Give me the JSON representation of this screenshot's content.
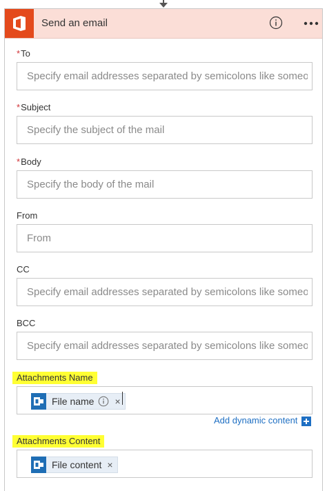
{
  "action_card": {
    "title": "Send an email",
    "header_color": "#fbded7",
    "app_icon": "office-icon",
    "app_icon_color": "#e44a1c"
  },
  "fields": {
    "to": {
      "label": "To",
      "required": true,
      "placeholder": "Specify email addresses separated by semicolons like someone@contoso.com"
    },
    "subject": {
      "label": "Subject",
      "required": true,
      "placeholder": "Specify the subject of the mail"
    },
    "body": {
      "label": "Body",
      "required": true,
      "placeholder": "Specify the body of the mail"
    },
    "from": {
      "label": "From",
      "required": false,
      "placeholder": "From"
    },
    "cc": {
      "label": "CC",
      "required": false,
      "placeholder": "Specify email addresses separated by semicolons like someone@contoso.com"
    },
    "bcc": {
      "label": "BCC",
      "required": false,
      "placeholder": "Specify email addresses separated by semicolons like someone@contoso.com"
    },
    "attachments_name": {
      "label": "Attachments Name",
      "token": {
        "label": "File name",
        "icon": "outlook-icon"
      }
    },
    "attachments_content": {
      "label": "Attachments Content",
      "token": {
        "label": "File content",
        "icon": "outlook-icon"
      }
    }
  },
  "dynamic_content": {
    "link_label": "Add dynamic content"
  },
  "colors": {
    "required_star": "#d13438",
    "label_highlight": "#ffff33",
    "link": "#1e6fc3",
    "token_icon": "#1f6eb5"
  }
}
